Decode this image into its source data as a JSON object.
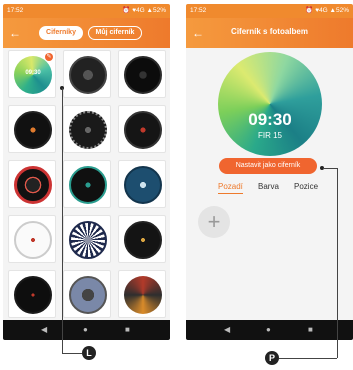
{
  "left_screen": {
    "status": {
      "time": "17:52",
      "icons": "⏰ ♥4G ▲52%"
    },
    "tabs": [
      {
        "label": "Ciferníky"
      },
      {
        "label": "Můj ciferník"
      }
    ],
    "faces": [
      {
        "time": "09:30"
      },
      {},
      {},
      {},
      {},
      {},
      {},
      {},
      {},
      {},
      {},
      {},
      {},
      {},
      {}
    ],
    "marker": "L"
  },
  "right_screen": {
    "status": {
      "time": "17:52",
      "icons": "⏰ ♥4G ▲52%"
    },
    "title": "Ciferník s fotoalbem",
    "preview": {
      "time": "09:30",
      "date": "FIR 15"
    },
    "set_button": "Nastavit jako ciferník",
    "options": [
      "Pozadí",
      "Barva",
      "Pozice"
    ],
    "add_icon": "+",
    "marker": "P"
  },
  "nav": {
    "back": "◀",
    "home": "●",
    "recent": "■"
  }
}
